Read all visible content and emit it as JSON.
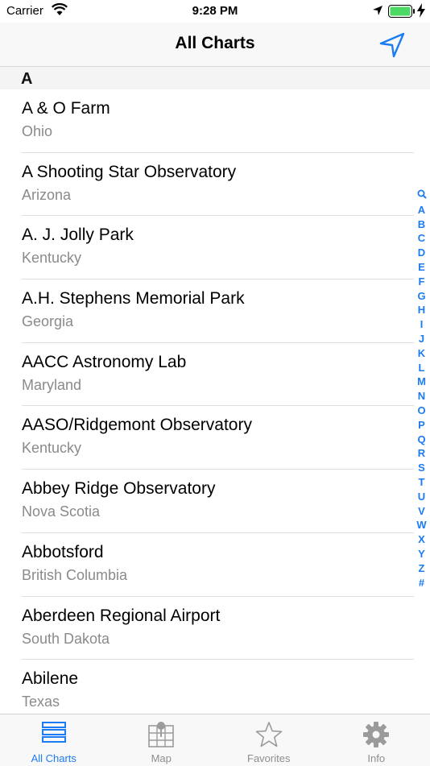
{
  "status_bar": {
    "carrier": "Carrier",
    "time": "9:28 PM"
  },
  "nav": {
    "title": "All Charts"
  },
  "section": {
    "letter": "A"
  },
  "rows": [
    {
      "name": "A & O Farm",
      "region": "Ohio"
    },
    {
      "name": "A Shooting Star Observatory",
      "region": "Arizona"
    },
    {
      "name": "A. J. Jolly Park",
      "region": "Kentucky"
    },
    {
      "name": "A.H. Stephens Memorial Park",
      "region": "Georgia"
    },
    {
      "name": "AACC Astronomy Lab",
      "region": "Maryland"
    },
    {
      "name": "AASO/Ridgemont Observatory",
      "region": "Kentucky"
    },
    {
      "name": "Abbey Ridge Observatory",
      "region": "Nova Scotia"
    },
    {
      "name": "Abbotsford",
      "region": "British Columbia"
    },
    {
      "name": "Aberdeen Regional Airport",
      "region": "South Dakota"
    },
    {
      "name": "Abilene",
      "region": "Texas"
    }
  ],
  "index": [
    "A",
    "B",
    "C",
    "D",
    "E",
    "F",
    "G",
    "H",
    "I",
    "J",
    "K",
    "L",
    "M",
    "N",
    "O",
    "P",
    "Q",
    "R",
    "S",
    "T",
    "U",
    "V",
    "W",
    "X",
    "Y",
    "Z",
    "#"
  ],
  "tabs": [
    {
      "label": "All Charts",
      "icon": "list-icon",
      "active": true
    },
    {
      "label": "Map",
      "icon": "map-icon"
    },
    {
      "label": "Favorites",
      "icon": "star-icon"
    },
    {
      "label": "Info",
      "icon": "gear-icon"
    }
  ],
  "colors": {
    "accent": "#1c7cf4",
    "secondary_text": "#8a8a8a",
    "tab_inactive": "#8e8e8e"
  }
}
